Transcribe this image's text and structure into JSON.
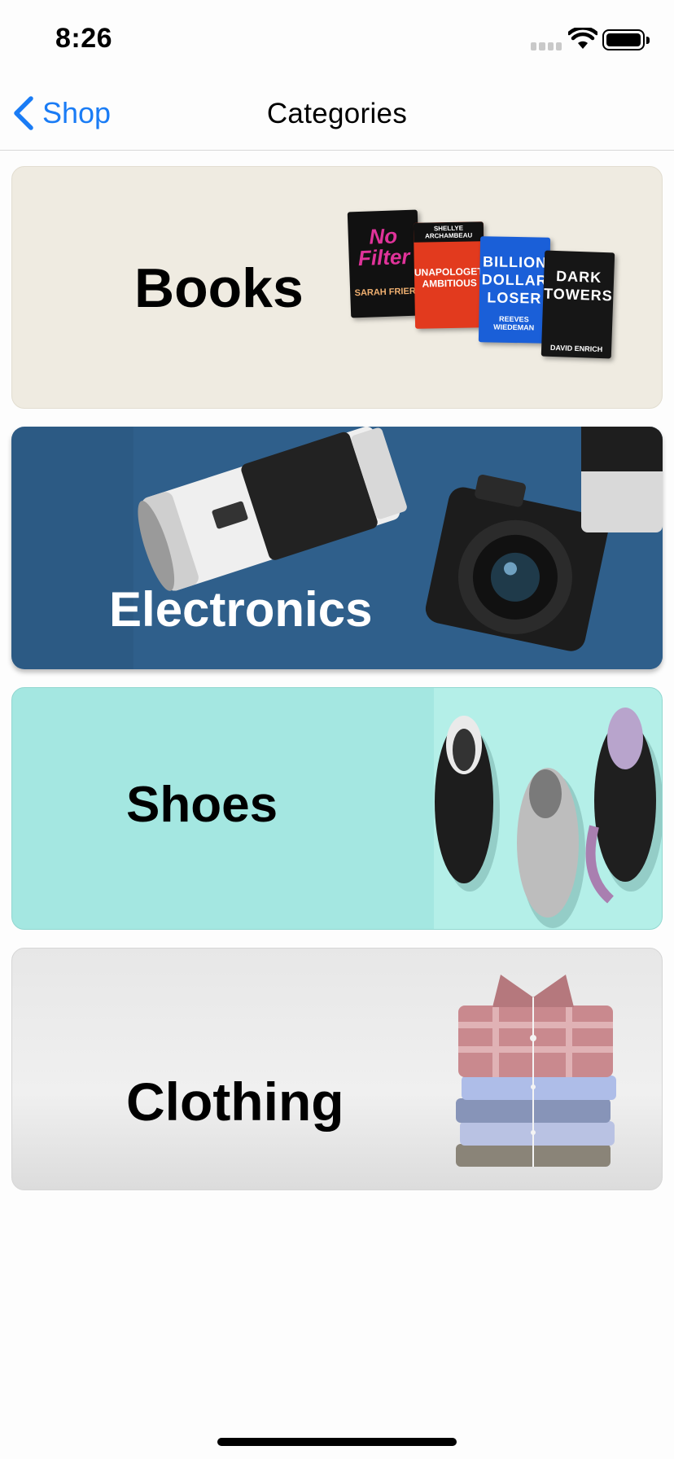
{
  "status_bar": {
    "time": "8:26"
  },
  "nav": {
    "back_label": "Shop",
    "title": "Categories"
  },
  "categories": [
    {
      "label": "Books"
    },
    {
      "label": "Electronics"
    },
    {
      "label": "Shoes"
    },
    {
      "label": "Clothing"
    }
  ],
  "books_covers": [
    {
      "title": "No Filter",
      "author": "SARAH FRIER",
      "color": "#111111"
    },
    {
      "title": "UNAPOLOGETICALLY AMBITIOUS",
      "author": "SHELLYE ARCHAMBEAU",
      "color": "#e23a1e"
    },
    {
      "title": "BILLION DOLLAR LOSER",
      "author": "REEVES WIEDEMAN",
      "color": "#1a5fd8"
    },
    {
      "title": "DARK TOWERS",
      "author": "DAVID ENRICH",
      "color": "#161616"
    }
  ],
  "colors": {
    "accent": "#1a7cf5"
  }
}
